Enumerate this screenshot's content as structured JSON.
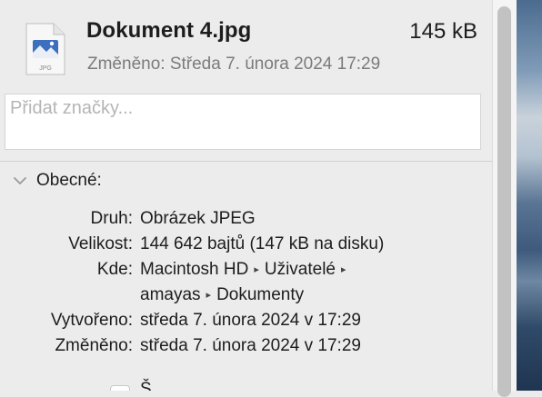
{
  "file": {
    "name": "Dokument 4.jpg",
    "size": "145 kB",
    "modified_label": "Změněno: Středa 7. února 2024 17:29",
    "icon": "jpeg-file-icon",
    "icon_badge": "JPG"
  },
  "tags": {
    "placeholder": "Přidat značky..."
  },
  "general": {
    "title": "Obecné:",
    "rows": [
      {
        "label": "Druh:",
        "value": "Obrázek JPEG"
      },
      {
        "label": "Velikost:",
        "value": "144 642 bajtů (147 kB na disku)"
      },
      {
        "label": "Kde:",
        "path": [
          "Macintosh HD",
          "Uživatelé",
          "amayas",
          "Dokumenty"
        ]
      },
      {
        "label": "Vytvořeno:",
        "value": "středa 7. února 2024 v 17:29"
      },
      {
        "label": "Změněno:",
        "value": "středa 7. února 2024 v 17:29"
      }
    ],
    "partial_checkbox_label": "Š"
  },
  "colors": {
    "background": "#ececec",
    "text": "#1d1d1d",
    "secondary_text": "#7b7b7b",
    "placeholder": "#b5b5b5"
  }
}
